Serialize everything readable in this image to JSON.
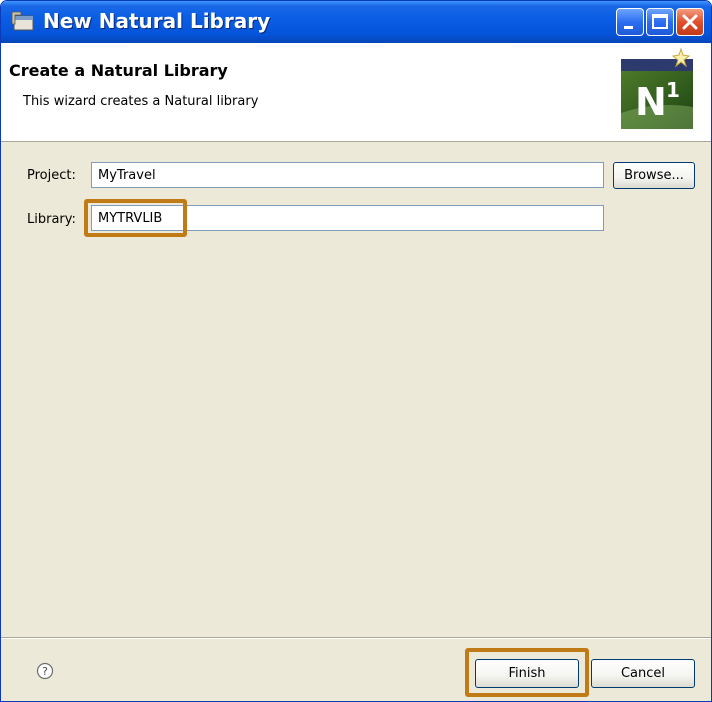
{
  "window": {
    "title": "New Natural Library"
  },
  "header": {
    "title": "Create a Natural Library",
    "description": "This wizard creates a Natural library",
    "logo_text": "N",
    "logo_superscript": "1"
  },
  "form": {
    "project_label": "Project:",
    "project_value": "MyTravel",
    "browse_label": "Browse...",
    "library_label": "Library:",
    "library_value": "MYTRVLIB"
  },
  "footer": {
    "finish_label": "Finish",
    "cancel_label": "Cancel"
  },
  "colors": {
    "title_bar": "#0553d8",
    "dialog_background": "#ece9d8",
    "highlight": "#c07a16"
  },
  "icons": {
    "title": "application-icon",
    "logo": "natural-logo-icon",
    "help": "help-icon",
    "minimize": "minimize-icon",
    "maximize": "maximize-icon",
    "close": "close-icon"
  }
}
